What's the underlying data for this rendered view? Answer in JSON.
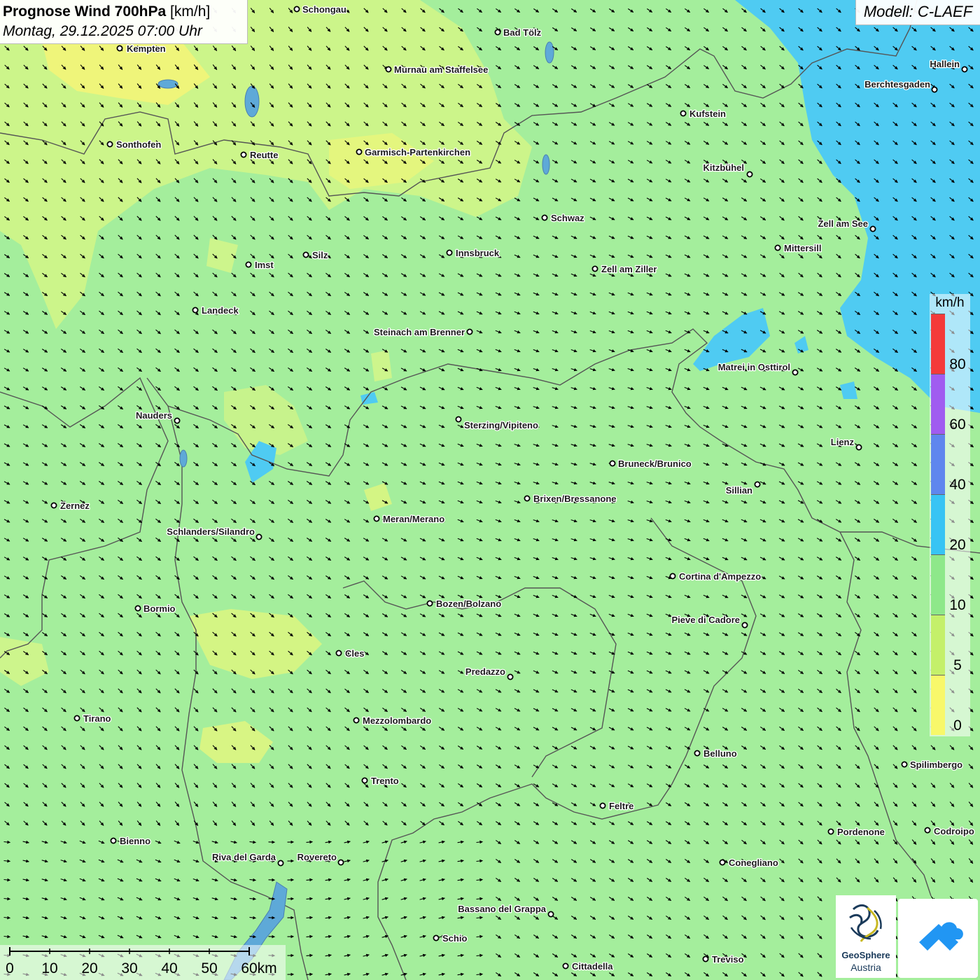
{
  "header": {
    "title_bold": "Prognose Wind 700hPa",
    "title_unit": " [km/h]",
    "datetime": "Montag, 29.12.2025 07:00 Uhr"
  },
  "model": {
    "label": "Modell: C-LAEF"
  },
  "legend": {
    "unit": "km/h",
    "bands": [
      {
        "from": 0,
        "to": 5,
        "color": "#f8f86a"
      },
      {
        "from": 5,
        "to": 10,
        "color": "#c4f06a"
      },
      {
        "from": 10,
        "to": 20,
        "color": "#8ee88a"
      },
      {
        "from": 20,
        "to": 40,
        "color": "#38c4f4"
      },
      {
        "from": 40,
        "to": 60,
        "color": "#5f86ee"
      },
      {
        "from": 60,
        "to": 80,
        "color": "#a05cf0"
      },
      {
        "from": 80,
        "to": null,
        "color": "#f43a3a"
      }
    ],
    "ticks": [
      "0",
      "5",
      "10",
      "20",
      "40",
      "60",
      "80"
    ]
  },
  "scalebar": {
    "labels": [
      "0",
      "10",
      "20",
      "30",
      "40",
      "50",
      "60km"
    ]
  },
  "branding": {
    "org_line1": "GeoSphere",
    "org_line2": "Austria"
  },
  "cities": [
    {
      "name": "Schongau"
    },
    {
      "name": "Bad Tölz"
    },
    {
      "name": "Kempten"
    },
    {
      "name": "Murnau am Staffelsee"
    },
    {
      "name": "Hallein"
    },
    {
      "name": "Berchtesgaden"
    },
    {
      "name": "Kufstein"
    },
    {
      "name": "Sonthofen"
    },
    {
      "name": "Reutte"
    },
    {
      "name": "Garmisch-Partenkirchen"
    },
    {
      "name": "Kitzbühel"
    },
    {
      "name": "Schwaz"
    },
    {
      "name": "Zell am See"
    },
    {
      "name": "Mittersill"
    },
    {
      "name": "Innsbruck"
    },
    {
      "name": "Silz"
    },
    {
      "name": "Imst"
    },
    {
      "name": "Zell am Ziller"
    },
    {
      "name": "Landeck"
    },
    {
      "name": "Steinach am Brenner"
    },
    {
      "name": "Matrei in Osttirol"
    },
    {
      "name": "Nauders"
    },
    {
      "name": "Sterzing/Vipiteno"
    },
    {
      "name": "Lienz"
    },
    {
      "name": "Bruneck/Brunico"
    },
    {
      "name": "Sillian"
    },
    {
      "name": "Brixen/Bressanone"
    },
    {
      "name": "Zernez"
    },
    {
      "name": "Meran/Merano"
    },
    {
      "name": "Schlanders/Silandro"
    },
    {
      "name": "Cortina d'Ampezzo"
    },
    {
      "name": "Bozen/Bolzano"
    },
    {
      "name": "Bormio"
    },
    {
      "name": "Pieve di Cadore"
    },
    {
      "name": "Cles"
    },
    {
      "name": "Predazzo"
    },
    {
      "name": "Tirano"
    },
    {
      "name": "Mezzolombardo"
    },
    {
      "name": "Belluno"
    },
    {
      "name": "Spilimbergo"
    },
    {
      "name": "Trento"
    },
    {
      "name": "Feltre"
    },
    {
      "name": "Pordenone"
    },
    {
      "name": "Codroipo"
    },
    {
      "name": "Bienno"
    },
    {
      "name": "Riva del Garda"
    },
    {
      "name": "Rovereto"
    },
    {
      "name": "Conegliano"
    },
    {
      "name": "Bassano del Grappa"
    },
    {
      "name": "Schio"
    },
    {
      "name": "Treviso"
    },
    {
      "name": "Cittadella"
    }
  ]
}
